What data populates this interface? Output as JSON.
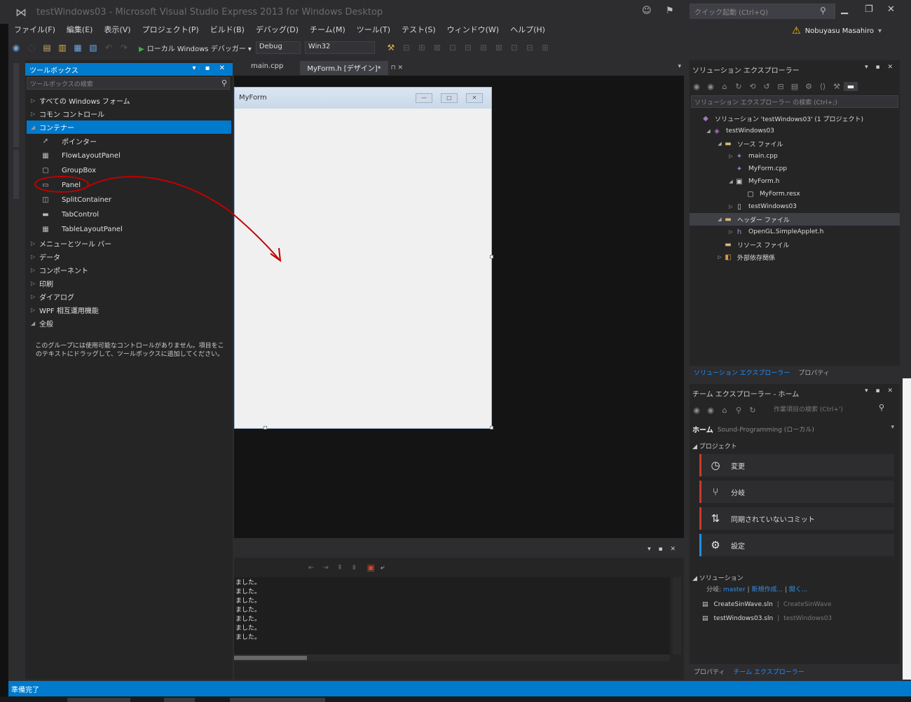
{
  "window": {
    "title": "testWindows03 - Microsoft Visual Studio Express 2013 for Windows Desktop",
    "quick_launch_placeholder": "クイック起動 (Ctrl+Q)"
  },
  "menu": [
    "ファイル(F)",
    "編集(E)",
    "表示(V)",
    "プロジェクト(P)",
    "ビルド(B)",
    "デバッグ(D)",
    "チーム(M)",
    "ツール(T)",
    "テスト(S)",
    "ウィンドウ(W)",
    "ヘルプ(H)"
  ],
  "account": "Nobuyasu Masahiro",
  "toolbar": {
    "run_label": "ローカル Windows デバッガー",
    "config": "Debug",
    "platform": "Win32"
  },
  "toolbox": {
    "title": "ツールボックス",
    "header_buttons": "▾ ▪ ✕",
    "search_placeholder": "ツールボックスの検索",
    "groups_top": [
      {
        "label": "すべての Windows フォーム",
        "expanded": false
      },
      {
        "label": "コモン コントロール",
        "expanded": false
      },
      {
        "label": "コンテナー",
        "expanded": true,
        "selected": true
      }
    ],
    "container_items": [
      {
        "icon": "pointer-icon",
        "glyph": "➚",
        "label": "ポインター"
      },
      {
        "icon": "flowlayoutpanel-icon",
        "glyph": "▦",
        "label": "FlowLayoutPanel"
      },
      {
        "icon": "groupbox-icon",
        "glyph": "▢",
        "label": "GroupBox"
      },
      {
        "icon": "panel-icon",
        "glyph": "▭",
        "label": "Panel"
      },
      {
        "icon": "splitcontainer-icon",
        "glyph": "◫",
        "label": "SplitContainer"
      },
      {
        "icon": "tabcontrol-icon",
        "glyph": "▬",
        "label": "TabControl"
      },
      {
        "icon": "tablelayoutpanel-icon",
        "glyph": "▦",
        "label": "TableLayoutPanel"
      }
    ],
    "groups_bottom": [
      {
        "label": "メニューとツール バー",
        "expanded": false
      },
      {
        "label": "データ",
        "expanded": false
      },
      {
        "label": "コンポーネント",
        "expanded": false
      },
      {
        "label": "印刷",
        "expanded": false
      },
      {
        "label": "ダイアログ",
        "expanded": false
      },
      {
        "label": "WPF 相互運用機能",
        "expanded": false
      },
      {
        "label": "全般",
        "expanded": true
      }
    ],
    "note": "このグループには使用可能なコントロールがありません。項目をこのテキストにドラッグして、ツールボックスに追加してください。"
  },
  "editor": {
    "tabs": [
      {
        "label": "main.cpp",
        "active": false
      },
      {
        "label": "MyForm.h [デザイン]*",
        "active": true
      }
    ],
    "form": {
      "title": "MyForm",
      "cap_buttons": [
        "—",
        "□",
        "✕"
      ]
    }
  },
  "output": {
    "header_buttons": "▾ ▪ ✕",
    "lines": [
      "ました。",
      "ました。",
      "ました。",
      "ました。",
      "ました。",
      "ました。",
      "ました。"
    ]
  },
  "solution_explorer": {
    "title": "ソリューション エクスプローラー",
    "header_buttons": "▾ ▪ ✕",
    "search_placeholder": "ソリューション エクスプローラー の検索 (Ctrl+;)",
    "tree": [
      {
        "depth": 0,
        "twisty": "",
        "icon": "solution-icon",
        "cls": "ic-sol",
        "glyph": "◆",
        "label": "ソリューション 'testWindows03' (1 プロジェクト)"
      },
      {
        "depth": 1,
        "twisty": "◢",
        "icon": "project-icon",
        "cls": "ic-proj",
        "glyph": "◈",
        "label": "testWindows03"
      },
      {
        "depth": 2,
        "twisty": "◢",
        "icon": "folder-icon",
        "cls": "ic-folder",
        "glyph": "▬",
        "label": "ソース ファイル"
      },
      {
        "depth": 3,
        "twisty": "▷",
        "icon": "cpp-file-icon",
        "cls": "ic-cpp",
        "glyph": "✦",
        "label": "main.cpp"
      },
      {
        "depth": 3,
        "twisty": "",
        "icon": "cpp-file-icon",
        "cls": "ic-cpp",
        "glyph": "✦",
        "label": "MyForm.cpp"
      },
      {
        "depth": 3,
        "twisty": "◢",
        "icon": "form-file-icon",
        "cls": "ic-form",
        "glyph": "▣",
        "label": "MyForm.h"
      },
      {
        "depth": 4,
        "twisty": "",
        "icon": "resx-file-icon",
        "cls": "ic-form",
        "glyph": "▢",
        "label": "MyForm.resx"
      },
      {
        "depth": 3,
        "twisty": "▷",
        "icon": "reference-icon",
        "cls": "ic-ref",
        "glyph": "▯",
        "label": "testWindows03"
      },
      {
        "depth": 2,
        "twisty": "◢",
        "icon": "folder-icon",
        "cls": "ic-folder",
        "glyph": "▬",
        "label": "ヘッダー ファイル",
        "selected": true
      },
      {
        "depth": 3,
        "twisty": "▷",
        "icon": "header-file-icon",
        "cls": "ic-h",
        "glyph": "h",
        "label": "OpenGL.SimpleApplet.h"
      },
      {
        "depth": 2,
        "twisty": "",
        "icon": "folder-icon",
        "cls": "ic-folder",
        "glyph": "▬",
        "label": "リソース ファイル"
      },
      {
        "depth": 2,
        "twisty": "▷",
        "icon": "external-deps-icon",
        "cls": "ic-ext",
        "glyph": "◧",
        "label": "外部依存関係"
      }
    ],
    "tabs": [
      {
        "label": "ソリューション エクスプローラー",
        "active": true
      },
      {
        "label": "プロパティ",
        "active": false
      }
    ]
  },
  "team_explorer": {
    "title": "チーム エクスプローラー - ホーム",
    "header_buttons": "▾ ▪ ✕",
    "search_placeholder": "作業項目の検索 (Ctrl+')",
    "home_label": "ホーム",
    "repo": "Sound-Programming (ローカル)",
    "project_label": "◢ プロジェクト",
    "tiles": [
      {
        "icon": "changes-icon",
        "glyph": "◷",
        "label": "変更",
        "accent": "red"
      },
      {
        "icon": "branches-icon",
        "glyph": "⑂",
        "label": "分岐",
        "accent": "red"
      },
      {
        "icon": "unsynced-commits-icon",
        "glyph": "⇅",
        "label": "同期されていないコミット",
        "accent": "red"
      },
      {
        "icon": "settings-icon",
        "glyph": "⚙",
        "label": "設定",
        "accent": "blue"
      }
    ],
    "solutions_label": "◢ ソリューション",
    "solution_links": {
      "prefix": "分岐:",
      "branch": "master",
      "new": "新規作成...",
      "open": "開く..."
    },
    "solution_rows": [
      {
        "name": "CreateSinWave.sln",
        "path": "CreateSinWave"
      },
      {
        "name": "testWindows03.sln",
        "path": "testWindows03"
      }
    ],
    "tabs": [
      {
        "label": "プロパティ",
        "active": false
      },
      {
        "label": "チーム エクスプローラー",
        "active": true
      }
    ]
  },
  "status": {
    "text": "準備完了"
  },
  "colors": {
    "accent": "#007acc",
    "annotation": "#c00000"
  }
}
